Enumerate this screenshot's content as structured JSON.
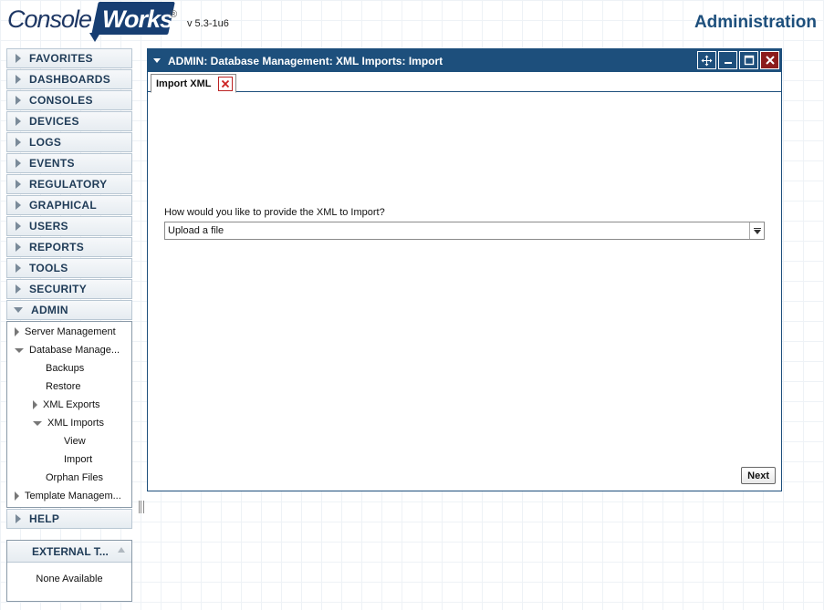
{
  "header": {
    "logo_console": "Console",
    "logo_works": "Works",
    "logo_reg": "®",
    "version": "v 5.3-1u6",
    "title": "Administration"
  },
  "sidebar": {
    "items_top": [
      {
        "label": "FAVORITES"
      },
      {
        "label": "DASHBOARDS"
      },
      {
        "label": "CONSOLES"
      },
      {
        "label": "DEVICES"
      },
      {
        "label": "LOGS"
      },
      {
        "label": "EVENTS"
      },
      {
        "label": "REGULATORY"
      },
      {
        "label": "GRAPHICAL"
      },
      {
        "label": "USERS"
      },
      {
        "label": "REPORTS"
      },
      {
        "label": "TOOLS"
      },
      {
        "label": "SECURITY"
      }
    ],
    "admin": {
      "label": "ADMIN",
      "tree": {
        "server_management": "Server Management",
        "database_management": "Database Manage...",
        "backups": "Backups",
        "restore": "Restore",
        "xml_exports": "XML Exports",
        "xml_imports": "XML Imports",
        "view": "View",
        "import": "Import",
        "orphan_files": "Orphan Files",
        "template_management": "Template Managem..."
      }
    },
    "help": "HELP"
  },
  "external": {
    "title": "EXTERNAL T...",
    "body": "None Available"
  },
  "window": {
    "title": "ADMIN: Database Management: XML Imports: Import",
    "tab_label": "Import XML",
    "form_label": "How would you like to provide the XML to Import?",
    "select_value": "Upload a file",
    "next_label": "Next"
  }
}
